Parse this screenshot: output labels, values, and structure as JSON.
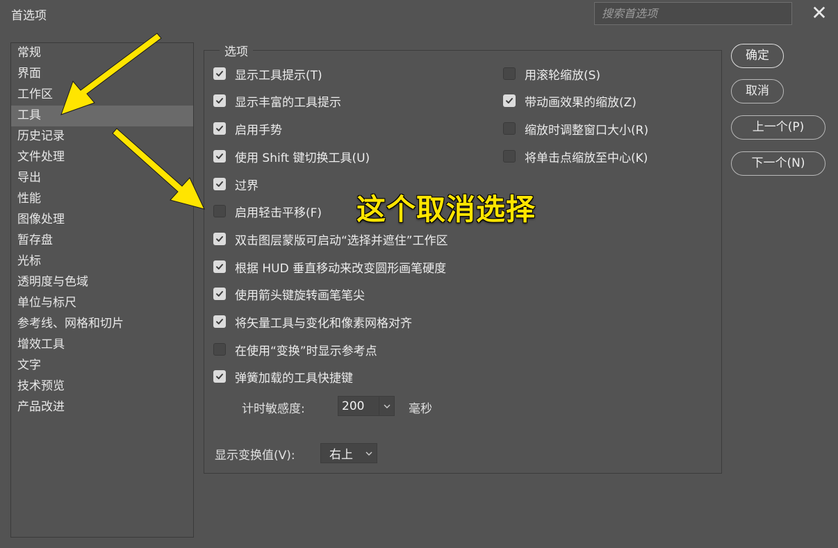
{
  "window": {
    "title": "首选项",
    "close_glyph": "✕"
  },
  "search": {
    "placeholder": "搜索首选项"
  },
  "sidebar": {
    "items": [
      {
        "label": "常规"
      },
      {
        "label": "界面"
      },
      {
        "label": "工作区"
      },
      {
        "label": "工具",
        "active": true
      },
      {
        "label": "历史记录"
      },
      {
        "label": "文件处理"
      },
      {
        "label": "导出"
      },
      {
        "label": "性能"
      },
      {
        "label": "图像处理"
      },
      {
        "label": "暂存盘"
      },
      {
        "label": "光标"
      },
      {
        "label": "透明度与色域"
      },
      {
        "label": "单位与标尺"
      },
      {
        "label": "参考线、网格和切片"
      },
      {
        "label": "增效工具"
      },
      {
        "label": "文字"
      },
      {
        "label": "技术预览"
      },
      {
        "label": "产品改进"
      }
    ]
  },
  "options": {
    "legend": "选项",
    "left": [
      {
        "label": "显示工具提示(T)",
        "checked": true
      },
      {
        "label": "显示丰富的工具提示",
        "checked": true
      },
      {
        "label": "启用手势",
        "checked": true
      },
      {
        "label": "使用 Shift 键切换工具(U)",
        "checked": true
      },
      {
        "label": "过界",
        "checked": true
      },
      {
        "label": "启用轻击平移(F)",
        "checked": false
      },
      {
        "label": "双击图层蒙版可启动“选择并遮住”工作区",
        "checked": true
      },
      {
        "label": "根据 HUD 垂直移动来改变圆形画笔硬度",
        "checked": true
      },
      {
        "label": "使用箭头键旋转画笔笔尖",
        "checked": true
      },
      {
        "label": "将矢量工具与变化和像素网格对齐",
        "checked": true
      },
      {
        "label": "在使用“变换”时显示参考点",
        "checked": false
      },
      {
        "label": "弹簧加载的工具快捷键",
        "checked": true
      }
    ],
    "right": [
      {
        "label": "用滚轮缩放(S)",
        "checked": false
      },
      {
        "label": "带动画效果的缩放(Z)",
        "checked": true
      },
      {
        "label": "缩放时调整窗口大小(R)",
        "checked": false
      },
      {
        "label": "将单击点缩放至中心(K)",
        "checked": false
      }
    ],
    "timer": {
      "label": "计时敏感度:",
      "value": "200",
      "unit": "毫秒"
    },
    "transform": {
      "label": "显示变换值(V):",
      "value": "右上"
    }
  },
  "buttons": {
    "ok": "确定",
    "cancel": "取消",
    "prev": "上一个(P)",
    "next": "下一个(N)"
  },
  "annotation": {
    "text": "这个取消选择",
    "color": "#ffe500"
  },
  "colors": {
    "background": "#535353",
    "accent_annotation": "#ffe500"
  }
}
